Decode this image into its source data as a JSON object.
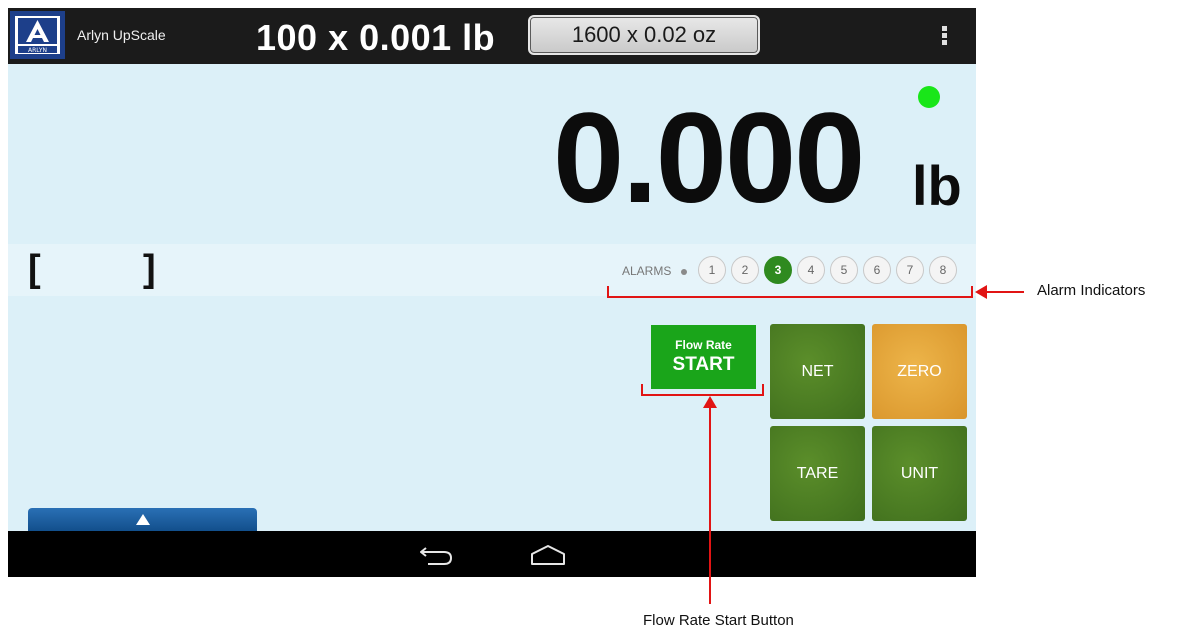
{
  "app": {
    "title": "Arlyn UpScale",
    "logo_text": "ARLYN"
  },
  "ranges": {
    "primary": "100 x 0.001 lb",
    "secondary": "1600 x 0.02 oz"
  },
  "display": {
    "weight": "0.000",
    "unit": "lb",
    "status_light_color": "#19e619"
  },
  "info": {
    "bracket_left": "[",
    "bracket_right": "]"
  },
  "alarms": {
    "label": "ALARMS",
    "items": [
      "1",
      "2",
      "3",
      "4",
      "5",
      "6",
      "7",
      "8"
    ],
    "active": "3",
    "active_color": "#2f8a1f"
  },
  "buttons": {
    "flowrate_caption": "Flow Rate",
    "flowrate_label": "START",
    "net": "NET",
    "zero": "ZERO",
    "tare": "TARE",
    "unit": "UNIT"
  },
  "nav": {
    "back_icon": "back-icon",
    "home_icon": "home-icon"
  },
  "annotations": {
    "alarm_indicators": "Alarm Indicators",
    "flow_rate_start_button": "Flow Rate Start Button",
    "callout_color": "#e11414"
  }
}
